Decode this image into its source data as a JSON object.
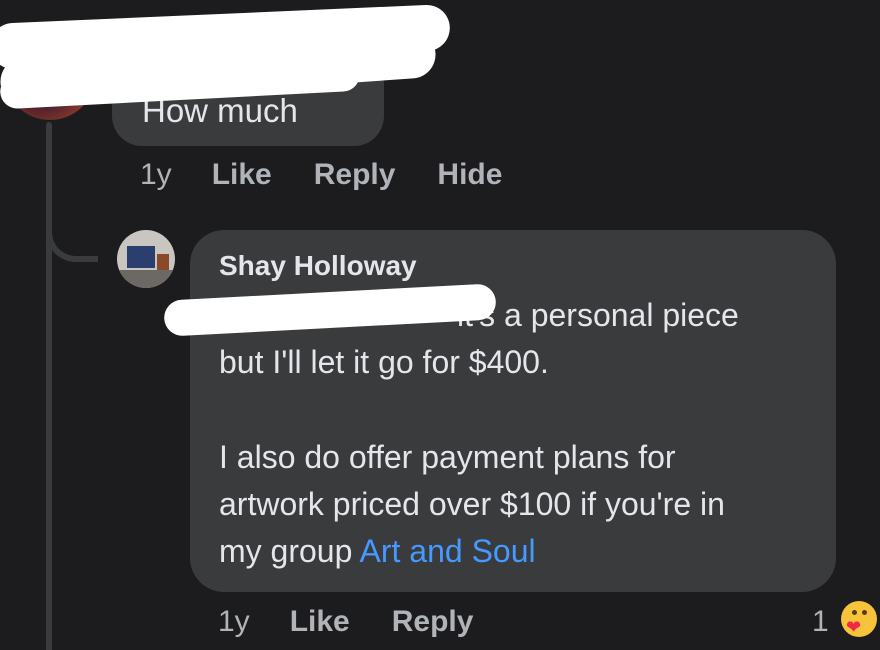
{
  "top_comment": {
    "text": "How much",
    "actions": {
      "time": "1y",
      "like": "Like",
      "reply": "Reply",
      "hide": "Hide"
    }
  },
  "reply_comment": {
    "author": "Shay Holloway",
    "mention_fragment": "...",
    "lines": [
      "it's a personal piece",
      "but I'll let it go for $400."
    ],
    "paragraph2_lines": [
      "I also do offer payment plans for",
      "artwork priced over $100 if you're in"
    ],
    "last_line_prefix": "my group ",
    "group_link": "Art and Soul",
    "actions": {
      "time": "1y",
      "like": "Like",
      "reply": "Reply"
    },
    "reaction_count": "1",
    "reaction_icon": "care-reaction-icon"
  },
  "colors": {
    "background": "#1c1c1e",
    "bubble": "#3a3b3c",
    "text": "#e4e6eb",
    "secondary_text": "#b0b3b8",
    "link": "#4599ff"
  }
}
